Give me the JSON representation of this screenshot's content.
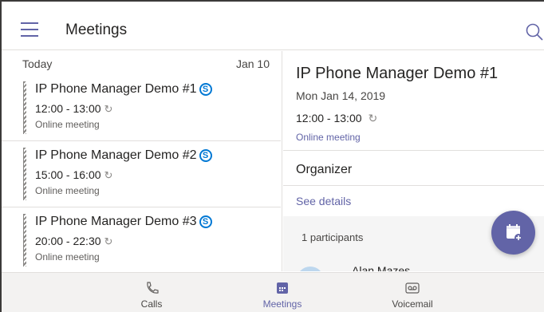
{
  "header": {
    "title": "Meetings",
    "menu_icon": "hamburger-menu-icon",
    "search_icon": "search-icon"
  },
  "list": {
    "day_label": "Today",
    "day_date": "Jan 10",
    "meetings": [
      {
        "title": "IP Phone Manager Demo #1",
        "time": "12:00 - 13:00",
        "kind": "Online meeting"
      },
      {
        "title": "IP Phone Manager Demo #2",
        "time": "15:00 - 16:00",
        "kind": "Online meeting"
      },
      {
        "title": "IP Phone Manager Demo #3",
        "time": "20:00 - 22:30",
        "kind": "Online meeting"
      }
    ]
  },
  "detail": {
    "title": "IP Phone Manager Demo #1",
    "date": "Mon Jan 14, 2019",
    "time": "12:00 - 13:00",
    "kind": "Online meeting",
    "organizer_label": "Organizer",
    "see_details": "See details",
    "participants": "1 participants",
    "participant_name": "Alan Mazes"
  },
  "tabs": [
    {
      "label": "Calls",
      "icon": "phone-icon",
      "active": false
    },
    {
      "label": "Meetings",
      "icon": "calendar-icon",
      "active": true
    },
    {
      "label": "Voicemail",
      "icon": "voicemail-icon",
      "active": false
    }
  ],
  "colors": {
    "accent": "#6264a7",
    "skype": "#0078d4",
    "divider": "#e1dfdd"
  }
}
